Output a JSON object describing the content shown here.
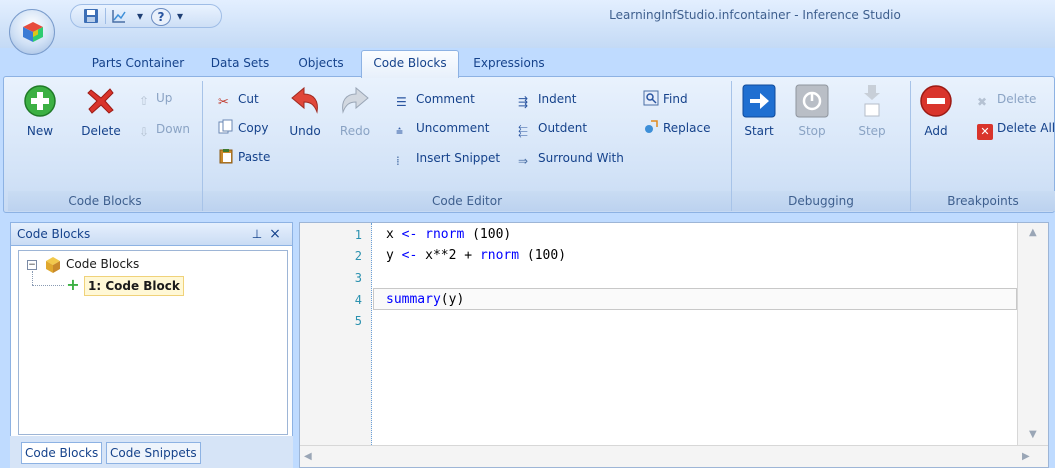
{
  "window": {
    "title": "LearningInfStudio.infcontainer - Inference Studio"
  },
  "qat": {
    "save_icon": "save-icon",
    "chart_icon": "chart-icon",
    "dropdown_glyph": "▾",
    "help_glyph": "?"
  },
  "tabs": [
    {
      "label": "Parts Container"
    },
    {
      "label": "Data Sets"
    },
    {
      "label": "Objects"
    },
    {
      "label": "Code Blocks",
      "active": true
    },
    {
      "label": "Expressions"
    }
  ],
  "ribbon": {
    "code_blocks": {
      "label": "Code Blocks",
      "new": "New",
      "delete": "Delete",
      "up": "Up",
      "down": "Down"
    },
    "code_editor": {
      "label": "Code Editor",
      "cut": "Cut",
      "copy": "Copy",
      "paste": "Paste",
      "undo": "Undo",
      "redo": "Redo",
      "comment": "Comment",
      "uncomment": "Uncomment",
      "insert_snippet": "Insert Snippet",
      "indent": "Indent",
      "outdent": "Outdent",
      "surround_with": "Surround With",
      "find": "Find",
      "replace": "Replace"
    },
    "debugging": {
      "label": "Debugging",
      "start": "Start",
      "stop": "Stop",
      "step": "Step"
    },
    "breakpoints": {
      "label": "Breakpoints",
      "add": "Add",
      "delete": "Delete",
      "delete_all": "Delete All"
    }
  },
  "panel": {
    "title": "Code Blocks",
    "pin": "ᵖ",
    "close": "×",
    "tree_root": "Code Blocks",
    "tree_child": "1: Code Block",
    "tabs": [
      "Code Blocks",
      "Code Snippets"
    ]
  },
  "editor": {
    "lines": [
      {
        "n": "1",
        "code": "x <- rnorm (100)"
      },
      {
        "n": "2",
        "code": "y <- x**2 + rnorm (100)"
      },
      {
        "n": "3",
        "code": ""
      },
      {
        "n": "4",
        "code": "summary(y)"
      },
      {
        "n": "5",
        "code": ""
      }
    ]
  },
  "colors": {
    "accent": "#15428b",
    "ribbon_bg": "#d3e3f7",
    "keyword": "#0000ff",
    "line_number": "#2b91af"
  }
}
